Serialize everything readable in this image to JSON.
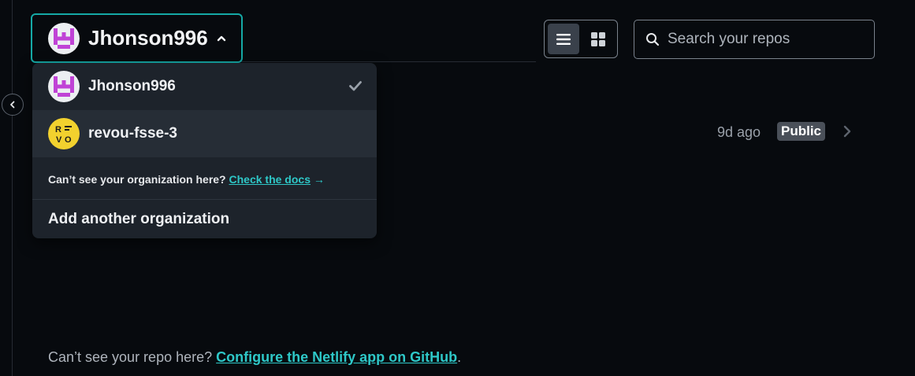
{
  "account": {
    "selected_name": "Jhonson996"
  },
  "view_toggle": {
    "list_icon": "list-icon",
    "grid_icon": "grid-icon"
  },
  "search": {
    "placeholder": "Search your repos",
    "value": ""
  },
  "repo_row": {
    "age": "9d ago",
    "visibility": "Public"
  },
  "dropdown": {
    "items": [
      {
        "label": "Jhonson996",
        "selected": true
      },
      {
        "label": "revou-fsse-3",
        "selected": false
      }
    ],
    "note_prefix": "Can’t see your organization here?",
    "note_link": "Check the docs",
    "note_arrow": "→",
    "add_org": "Add another organization"
  },
  "footer": {
    "prefix": "Can’t see your repo here?",
    "link": "Configure the Netlify app on GitHub",
    "suffix": "."
  },
  "colors": {
    "accent": "#15a9a6",
    "link": "#2ec8c8",
    "background": "#070a0e",
    "dropdown_bg": "#1d232b"
  }
}
